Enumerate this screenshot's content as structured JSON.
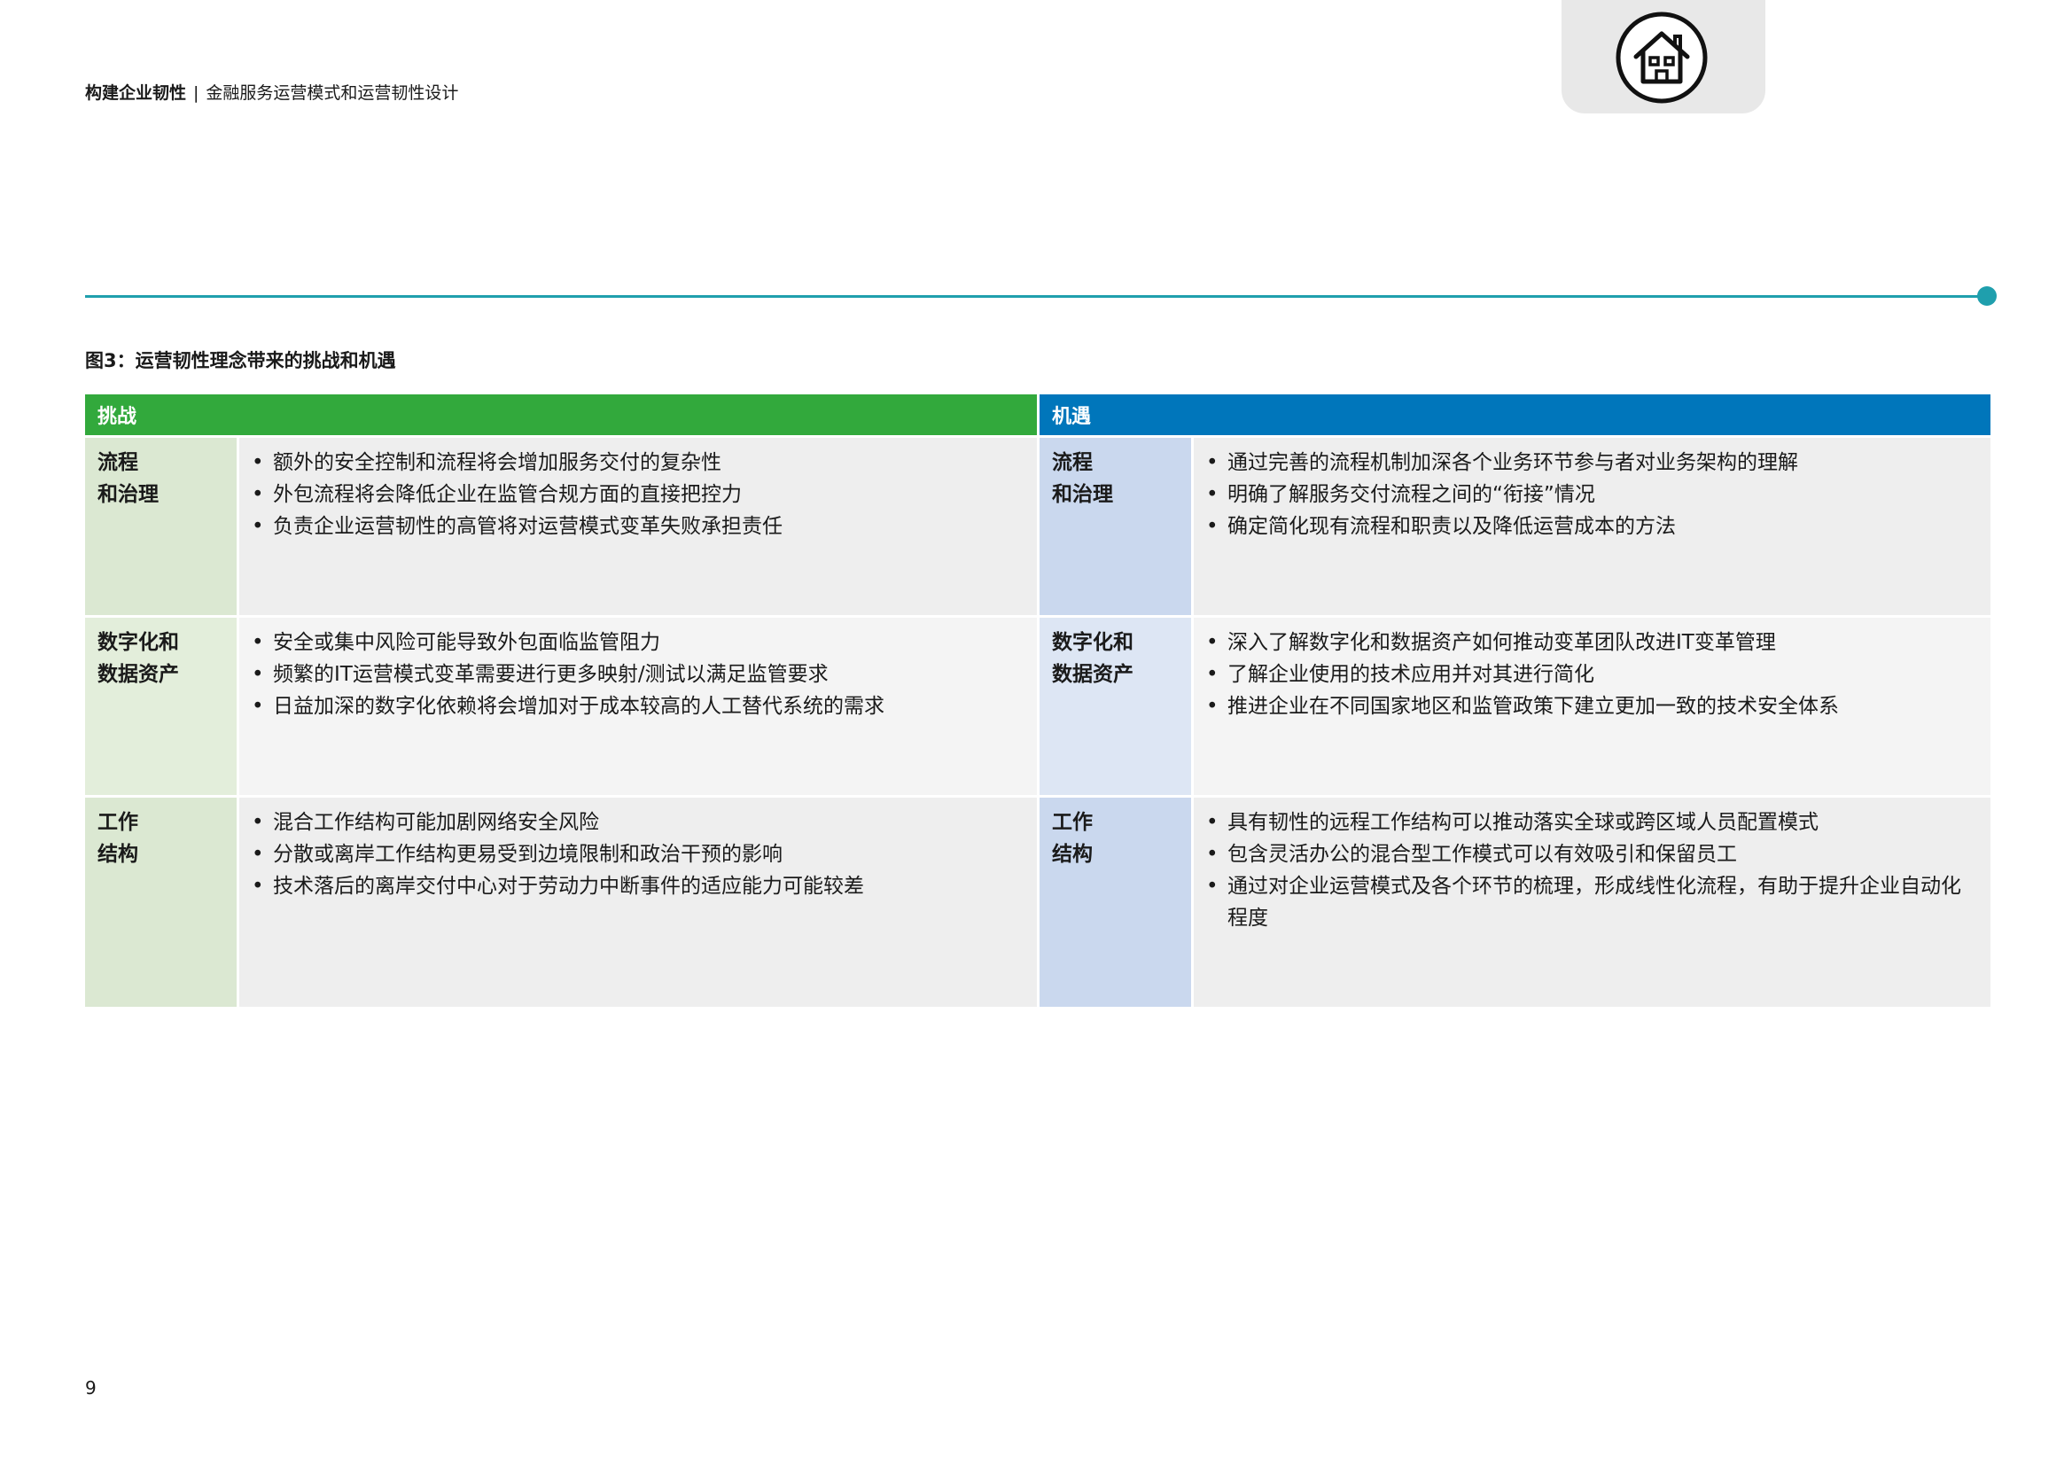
{
  "header": {
    "title": "构建企业韧性",
    "separator": "|",
    "subtitle": "金融服务运营模式和运营韧性设计"
  },
  "home_button": {
    "icon": "home-icon"
  },
  "figure": {
    "title": "图3：运营韧性理念带来的挑战和机遇",
    "columns": {
      "challenge": "挑战",
      "opportunity": "机遇"
    },
    "rows": [
      {
        "challenge_category": [
          "流程",
          "和治理"
        ],
        "challenges": [
          "额外的安全控制和流程将会增加服务交付的复杂性",
          "外包流程将会降低企业在监管合规方面的直接把控力",
          "负责企业运营韧性的高管将对运营模式变革失败承担责任"
        ],
        "opportunity_category": [
          "流程",
          "和治理"
        ],
        "opportunities": [
          "通过完善的流程机制加深各个业务环节参与者对业务架构的理解",
          "明确了解服务交付流程之间的“衔接”情况",
          "确定简化现有流程和职责以及降低运营成本的方法"
        ]
      },
      {
        "challenge_category": [
          "数字化和",
          "数据资产"
        ],
        "challenges": [
          "安全或集中风险可能导致外包面临监管阻力",
          "频繁的IT运营模式变革需要进行更多映射/测试以满足监管要求",
          "日益加深的数字化依赖将会增加对于成本较高的人工替代系统的需求"
        ],
        "opportunity_category": [
          "数字化和",
          "数据资产"
        ],
        "opportunities": [
          "深入了解数字化和数据资产如何推动变革团队改进IT变革管理",
          "了解企业使用的技术应用并对其进行简化",
          "推进企业在不同国家地区和监管政策下建立更加一致的技术安全体系"
        ]
      },
      {
        "challenge_category": [
          "工作",
          "结构"
        ],
        "challenges": [
          "混合工作结构可能加剧网络安全风险",
          "分散或离岸工作结构更易受到边境限制和政治干预的影响",
          "技术落后的离岸交付中心对于劳动力中断事件的适应能力可能较差"
        ],
        "opportunity_category": [
          "工作",
          "结构"
        ],
        "opportunities": [
          "具有韧性的远程工作结构可以推动落实全球或跨区域人员配置模式",
          "包含灵活办公的混合型工作模式可以有效吸引和保留员工",
          "通过对企业运营模式及各个环节的梳理，形成线性化流程，有助于提升企业自动化程度"
        ]
      }
    ]
  },
  "page_number": "9",
  "colors": {
    "accent_teal": "#1f9fad",
    "challenge_green": "#32a93c",
    "opportunity_blue": "#0076bb"
  }
}
